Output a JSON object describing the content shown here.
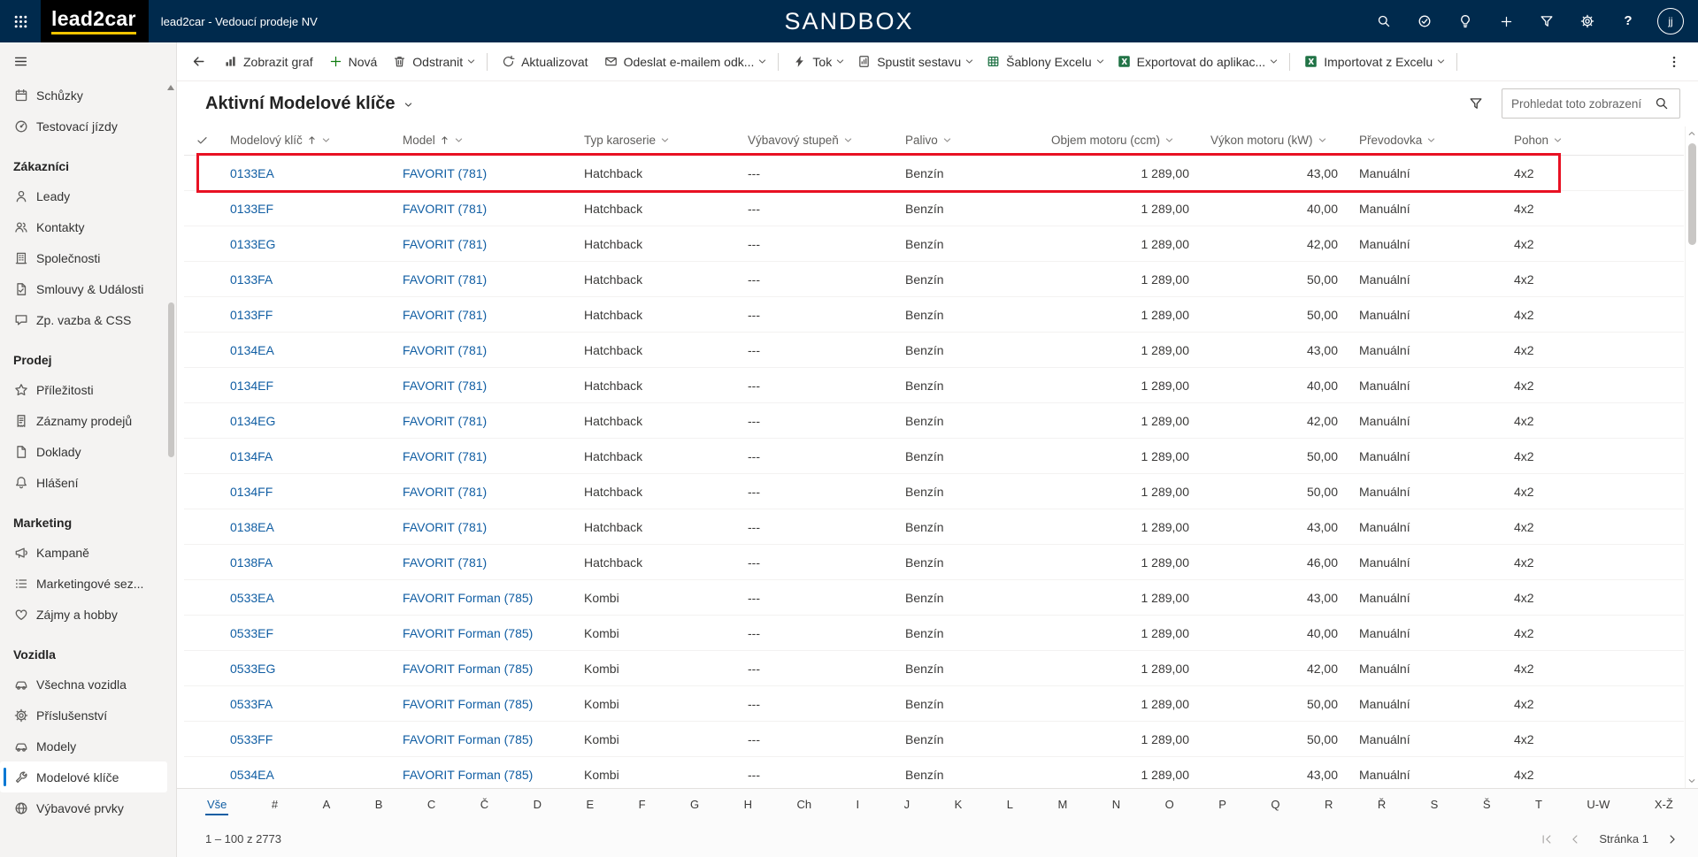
{
  "colors": {
    "navbar": "#002a4d",
    "logo_underline": "#f2c400",
    "accent": "#0078d4",
    "link": "#115ea3",
    "annotation": "#e81123",
    "excel_green": "#217346",
    "plus_green": "#107c10",
    "text": "#323130",
    "muted": "#605e5c"
  },
  "topbar": {
    "logo": "lead2car",
    "subtitle": "lead2car - Vedoucí prodeje NV",
    "environment": "SANDBOX",
    "avatar_initials": "jj",
    "actions": [
      {
        "name": "search",
        "icon": "search"
      },
      {
        "name": "check-circle",
        "icon": "check-circle"
      },
      {
        "name": "ideas",
        "icon": "bulb"
      },
      {
        "name": "quick-create",
        "icon": "plus"
      },
      {
        "name": "filter",
        "icon": "funnel"
      },
      {
        "name": "settings",
        "icon": "gear"
      },
      {
        "name": "help",
        "icon": "question"
      }
    ]
  },
  "sidebar": {
    "top_items": [
      {
        "name": "schuzky",
        "icon": "calendar",
        "label": "Schůzky"
      },
      {
        "name": "testovaci-jizdy",
        "icon": "speedo",
        "label": "Testovací jízdy"
      }
    ],
    "sections": [
      {
        "title": "Zákazníci",
        "items": [
          {
            "name": "leady",
            "icon": "person",
            "label": "Leady"
          },
          {
            "name": "kontakty",
            "icon": "people",
            "label": "Kontakty"
          },
          {
            "name": "spolecnosti",
            "icon": "building",
            "label": "Společnosti"
          },
          {
            "name": "smlouvy-a-udalosti",
            "icon": "doc-check",
            "label": "Smlouvy & Události"
          },
          {
            "name": "zpetna-vazba-css",
            "icon": "chat",
            "label": "Zp. vazba & CSS"
          }
        ]
      },
      {
        "title": "Prodej",
        "items": [
          {
            "name": "prilezitosti",
            "icon": "star",
            "label": "Příležitosti"
          },
          {
            "name": "zaznamy-prodeju",
            "icon": "receipt",
            "label": "Záznamy prodejů"
          },
          {
            "name": "doklady",
            "icon": "doc",
            "label": "Doklady"
          },
          {
            "name": "hlaseni",
            "icon": "bell",
            "label": "Hlášení"
          }
        ]
      },
      {
        "title": "Marketing",
        "items": [
          {
            "name": "kampane",
            "icon": "megaphone",
            "label": "Kampaně"
          },
          {
            "name": "marketingove-seznamy",
            "icon": "list",
            "label": "Marketingové sez..."
          },
          {
            "name": "zajmy-a-hobby",
            "icon": "heart",
            "label": "Zájmy a hobby"
          }
        ]
      },
      {
        "title": "Vozidla",
        "items": [
          {
            "name": "vsechna-vozidla",
            "icon": "car",
            "label": "Všechna vozidla"
          },
          {
            "name": "prislusenstvi",
            "icon": "gear",
            "label": "Příslušenství"
          },
          {
            "name": "modely",
            "icon": "car",
            "label": "Modely"
          },
          {
            "name": "modelove-klice",
            "icon": "wrench",
            "label": "Modelové klíče",
            "selected": true
          },
          {
            "name": "vybavove-prvky",
            "icon": "globe",
            "label": "Výbavové prvky"
          }
        ]
      }
    ]
  },
  "command_bar": {
    "buttons": [
      {
        "name": "show-chart",
        "icon": "chart",
        "label": "Zobrazit graf"
      },
      {
        "name": "new",
        "icon": "plus",
        "label": "Nová",
        "icon_color": "#107c10"
      },
      {
        "name": "delete",
        "icon": "trash",
        "label": "Odstranit",
        "chevron": true,
        "divider_after": true
      },
      {
        "name": "refresh",
        "icon": "refresh",
        "label": "Aktualizovat"
      },
      {
        "name": "email-link",
        "icon": "mail",
        "label": "Odeslat e-mailem odk...",
        "chevron": true,
        "divider_after": true
      },
      {
        "name": "flow",
        "icon": "flow",
        "label": "Tok",
        "chevron": true
      },
      {
        "name": "run-report",
        "icon": "report",
        "label": "Spustit sestavu",
        "chevron": true
      },
      {
        "name": "excel-templates",
        "icon": "excel-grid",
        "label": "Šablony Excelu",
        "chevron": true,
        "icon_color": "#217346"
      },
      {
        "name": "export-excel",
        "icon": "excel",
        "label": "Exportovat do aplikac...",
        "chevron": true,
        "icon_color": "#217346",
        "divider_after": true
      },
      {
        "name": "import-excel",
        "icon": "excel",
        "label": "Importovat z Excelu",
        "chevron": true,
        "icon_color": "#217346",
        "divider_after": true
      }
    ]
  },
  "view": {
    "title": "Aktivní Modelové klíče",
    "search_placeholder": "Prohledat toto zobrazení"
  },
  "table": {
    "columns": [
      {
        "name": "model-key",
        "label": "Modelový klíč",
        "sorted": true,
        "type": "link"
      },
      {
        "name": "model",
        "label": "Model",
        "sorted": true,
        "type": "link"
      },
      {
        "name": "body-type",
        "label": "Typ karoserie"
      },
      {
        "name": "trim-level",
        "label": "Výbavový stupeň"
      },
      {
        "name": "fuel",
        "label": "Palivo"
      },
      {
        "name": "engine-volume",
        "label": "Objem motoru (ccm)",
        "align": "right"
      },
      {
        "name": "engine-power",
        "label": "Výkon motoru (kW)",
        "align": "right"
      },
      {
        "name": "transmission",
        "label": "Převodovka"
      },
      {
        "name": "drive",
        "label": "Pohon"
      }
    ],
    "rows": [
      [
        "0133EA",
        "FAVORIT (781)",
        "Hatchback",
        "---",
        "Benzín",
        "1 289,00",
        "43,00",
        "Manuální",
        "4x2"
      ],
      [
        "0133EF",
        "FAVORIT (781)",
        "Hatchback",
        "---",
        "Benzín",
        "1 289,00",
        "40,00",
        "Manuální",
        "4x2"
      ],
      [
        "0133EG",
        "FAVORIT (781)",
        "Hatchback",
        "---",
        "Benzín",
        "1 289,00",
        "42,00",
        "Manuální",
        "4x2"
      ],
      [
        "0133FA",
        "FAVORIT (781)",
        "Hatchback",
        "---",
        "Benzín",
        "1 289,00",
        "50,00",
        "Manuální",
        "4x2"
      ],
      [
        "0133FF",
        "FAVORIT (781)",
        "Hatchback",
        "---",
        "Benzín",
        "1 289,00",
        "50,00",
        "Manuální",
        "4x2"
      ],
      [
        "0134EA",
        "FAVORIT (781)",
        "Hatchback",
        "---",
        "Benzín",
        "1 289,00",
        "43,00",
        "Manuální",
        "4x2"
      ],
      [
        "0134EF",
        "FAVORIT (781)",
        "Hatchback",
        "---",
        "Benzín",
        "1 289,00",
        "40,00",
        "Manuální",
        "4x2"
      ],
      [
        "0134EG",
        "FAVORIT (781)",
        "Hatchback",
        "---",
        "Benzín",
        "1 289,00",
        "42,00",
        "Manuální",
        "4x2"
      ],
      [
        "0134FA",
        "FAVORIT (781)",
        "Hatchback",
        "---",
        "Benzín",
        "1 289,00",
        "50,00",
        "Manuální",
        "4x2"
      ],
      [
        "0134FF",
        "FAVORIT (781)",
        "Hatchback",
        "---",
        "Benzín",
        "1 289,00",
        "50,00",
        "Manuální",
        "4x2"
      ],
      [
        "0138EA",
        "FAVORIT (781)",
        "Hatchback",
        "---",
        "Benzín",
        "1 289,00",
        "43,00",
        "Manuální",
        "4x2"
      ],
      [
        "0138FA",
        "FAVORIT (781)",
        "Hatchback",
        "---",
        "Benzín",
        "1 289,00",
        "46,00",
        "Manuální",
        "4x2"
      ],
      [
        "0533EA",
        "FAVORIT Forman (785)",
        "Kombi",
        "---",
        "Benzín",
        "1 289,00",
        "43,00",
        "Manuální",
        "4x2"
      ],
      [
        "0533EF",
        "FAVORIT Forman (785)",
        "Kombi",
        "---",
        "Benzín",
        "1 289,00",
        "40,00",
        "Manuální",
        "4x2"
      ],
      [
        "0533EG",
        "FAVORIT Forman (785)",
        "Kombi",
        "---",
        "Benzín",
        "1 289,00",
        "42,00",
        "Manuální",
        "4x2"
      ],
      [
        "0533FA",
        "FAVORIT Forman (785)",
        "Kombi",
        "---",
        "Benzín",
        "1 289,00",
        "50,00",
        "Manuální",
        "4x2"
      ],
      [
        "0533FF",
        "FAVORIT Forman (785)",
        "Kombi",
        "---",
        "Benzín",
        "1 289,00",
        "50,00",
        "Manuální",
        "4x2"
      ],
      [
        "0534EA",
        "FAVORIT Forman (785)",
        "Kombi",
        "---",
        "Benzín",
        "1 289,00",
        "43,00",
        "Manuální",
        "4x2"
      ]
    ]
  },
  "annotation": {
    "row_index": 0
  },
  "jumpbar": {
    "selected": "Vše",
    "letters": [
      "Vše",
      "#",
      "A",
      "B",
      "C",
      "Č",
      "D",
      "E",
      "F",
      "G",
      "H",
      "Ch",
      "I",
      "J",
      "K",
      "L",
      "M",
      "N",
      "O",
      "P",
      "Q",
      "R",
      "Ř",
      "S",
      "Š",
      "T",
      "U-W",
      "X-Ž"
    ]
  },
  "status": {
    "records": "1 – 100 z 2773",
    "page_label": "Stránka 1",
    "pager": [
      {
        "name": "first-page",
        "icon": "page-first",
        "disabled": true
      },
      {
        "name": "previous-page",
        "icon": "page-prev",
        "disabled": true
      },
      {
        "name": "next-page",
        "icon": "page-next",
        "disabled": false
      }
    ]
  }
}
